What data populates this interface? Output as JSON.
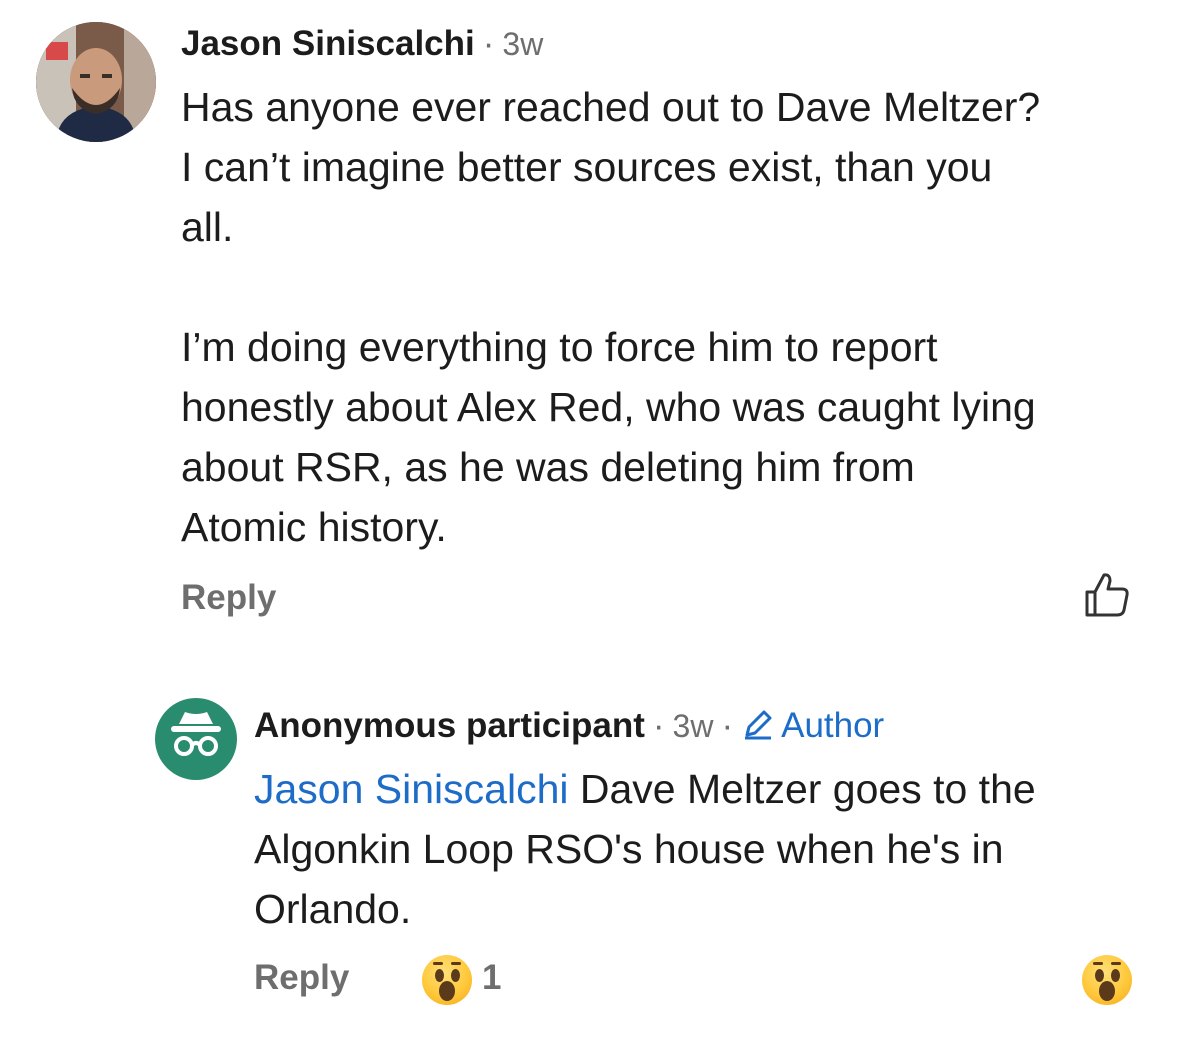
{
  "comments": [
    {
      "author": "Jason Siniscalchi",
      "separator": "·",
      "time": "3w",
      "avatar_icon": "user-photo",
      "text": "Has anyone ever reached out to Dave Meltzer?\nI can’t imagine better sources exist, than you\nall.\n\nI’m doing everything to force him to report\nhonestly about Alex Red, who was caught lying\nabout RSR, as he was deleting him from\nAtomic history.",
      "reply_label": "Reply",
      "like_icon": "thumbs-up-icon"
    },
    {
      "author": "Anonymous participant",
      "separator": "·",
      "time": "3w",
      "separator2": "·",
      "badge": "Author",
      "badge_icon": "pencil-icon",
      "avatar_icon": "incognito-icon",
      "avatar_color": "#2a8c6e",
      "mention": "Jason Siniscalchi",
      "text": " Dave Meltzer goes to the\nAlgonkin Loop RSO's house when he's in\nOrlando.",
      "reply_label": "Reply",
      "reaction_icon": "astonished-face-emoji",
      "reaction_count": "1",
      "react_button_icon": "astonished-face-emoji"
    }
  ],
  "colors": {
    "link": "#1d6cc8",
    "muted": "#6e6e6e",
    "text": "#1c1c1c"
  }
}
